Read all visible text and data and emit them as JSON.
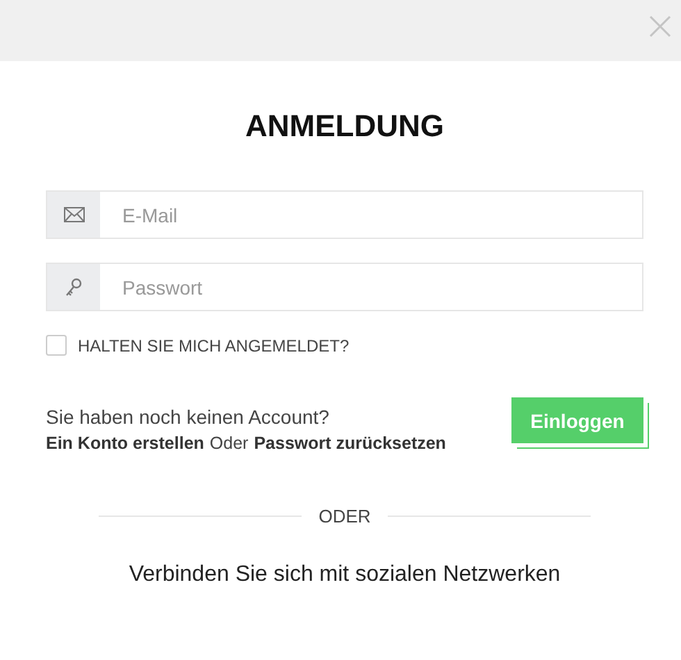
{
  "title": "ANMELDUNG",
  "fields": [
    {
      "kind": "email",
      "placeholder": "E-Mail"
    },
    {
      "kind": "password",
      "placeholder": "Passwort"
    }
  ],
  "remember": {
    "label": "HALTEN SIE MICH ANGEMELDET?",
    "checked": false
  },
  "no_account": "Sie haben noch keinen Account?",
  "register_link": "Ein Konto erstellen",
  "or_text": "Oder",
  "reset_link": "Passwort zurücksetzen",
  "login_button": "Einloggen",
  "divider": "ODER",
  "social_text": "Verbinden Sie sich mit sozialen Netzwerken"
}
